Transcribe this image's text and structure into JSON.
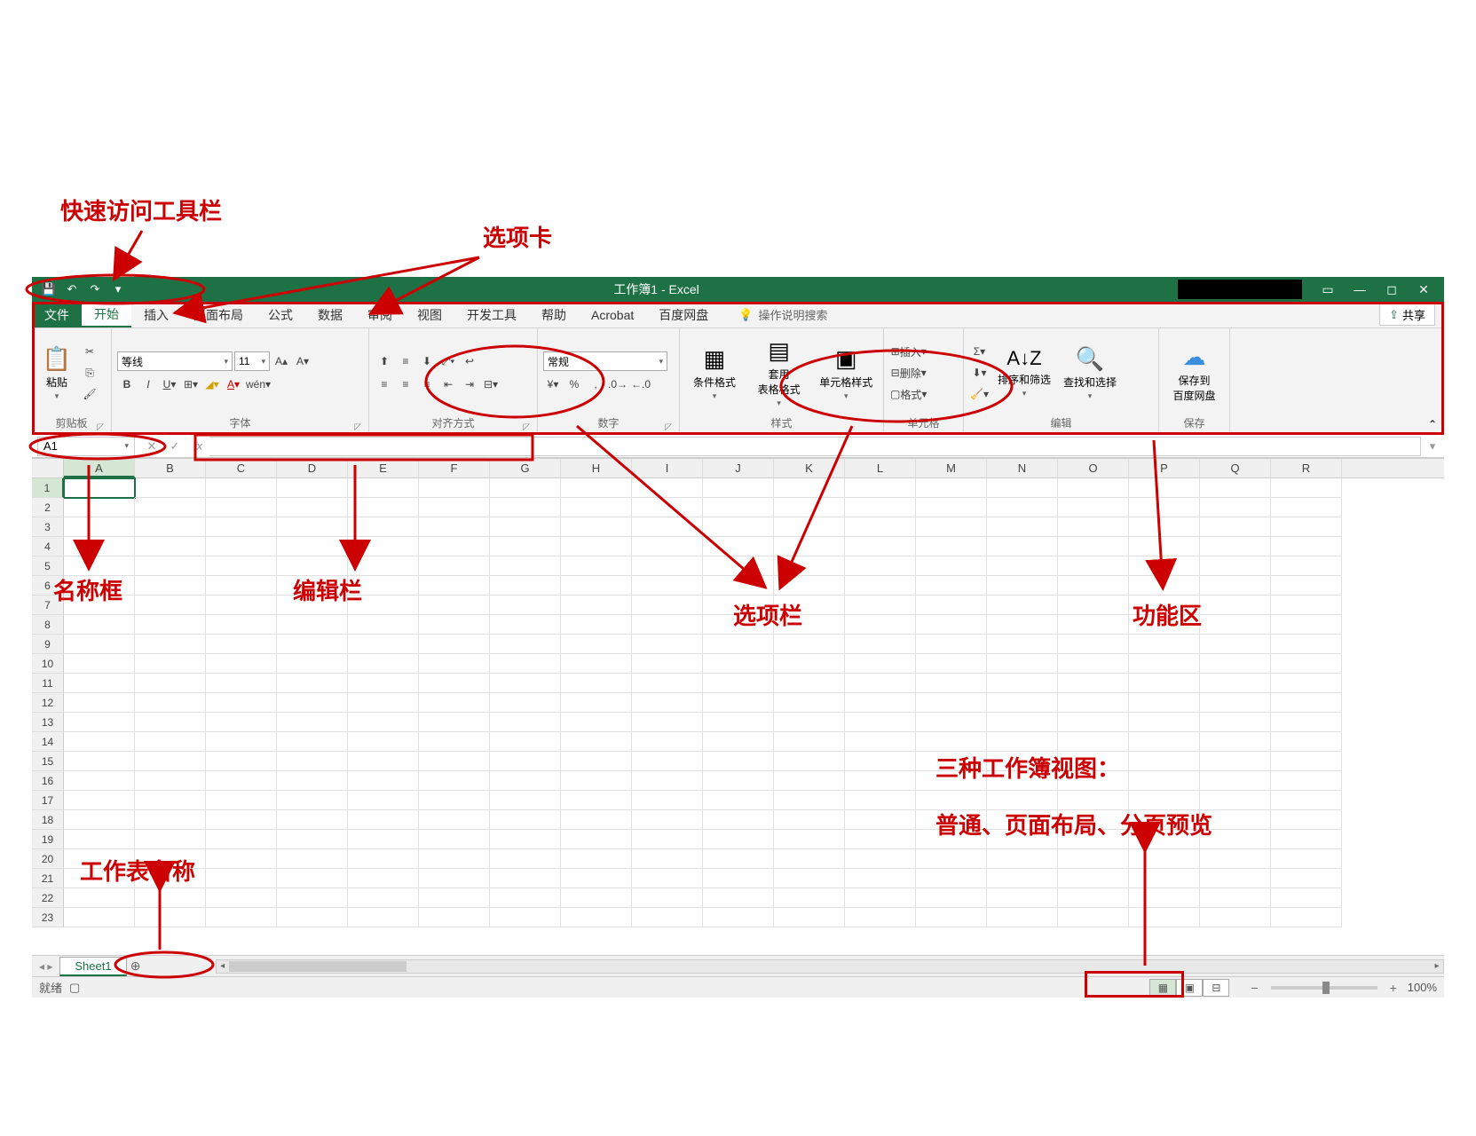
{
  "annotations": {
    "qat": "快速访问工具栏",
    "tabs": "选项卡",
    "namebox": "名称框",
    "formulabar": "编辑栏",
    "optionbar": "选项栏",
    "ribbon": "功能区",
    "sheet": "工作表名称",
    "views_title": "三种工作簿视图：",
    "views_sub": "普通、页面布局、分页预览"
  },
  "title": "工作簿1 - Excel",
  "tabs": {
    "file": "文件",
    "home": "开始",
    "insert": "插入",
    "pagelayout": "页面布局",
    "formulas": "公式",
    "data": "数据",
    "review": "审阅",
    "view": "视图",
    "developer": "开发工具",
    "help": "帮助",
    "acrobat": "Acrobat",
    "baidu": "百度网盘"
  },
  "tell_me": "操作说明搜索",
  "share": "共享",
  "ribbon_groups": {
    "clipboard": {
      "label": "剪贴板",
      "paste": "粘贴"
    },
    "font": {
      "label": "字体",
      "name": "等线",
      "size": "11"
    },
    "alignment": {
      "label": "对齐方式"
    },
    "number": {
      "label": "数字",
      "format": "常规"
    },
    "styles": {
      "label": "样式",
      "cond": "条件格式",
      "table": "套用\n表格格式",
      "cell": "单元格样式"
    },
    "cells": {
      "label": "单元格",
      "insert": "插入",
      "delete": "删除",
      "format": "格式"
    },
    "editing": {
      "label": "编辑",
      "sort": "排序和筛选",
      "find": "查找和选择"
    },
    "save": {
      "label": "保存",
      "baidu": "保存到\n百度网盘"
    }
  },
  "name_box": "A1",
  "columns": [
    "A",
    "B",
    "C",
    "D",
    "E",
    "F",
    "G",
    "H",
    "I",
    "J",
    "K",
    "L",
    "M",
    "N",
    "O",
    "P",
    "Q",
    "R"
  ],
  "rows": [
    1,
    2,
    3,
    4,
    5,
    6,
    7,
    8,
    9,
    10,
    11,
    12,
    13,
    14,
    15,
    16,
    17,
    18,
    19,
    20,
    21,
    22,
    23
  ],
  "sheet_name": "Sheet1",
  "status": "就绪",
  "zoom": "100%"
}
